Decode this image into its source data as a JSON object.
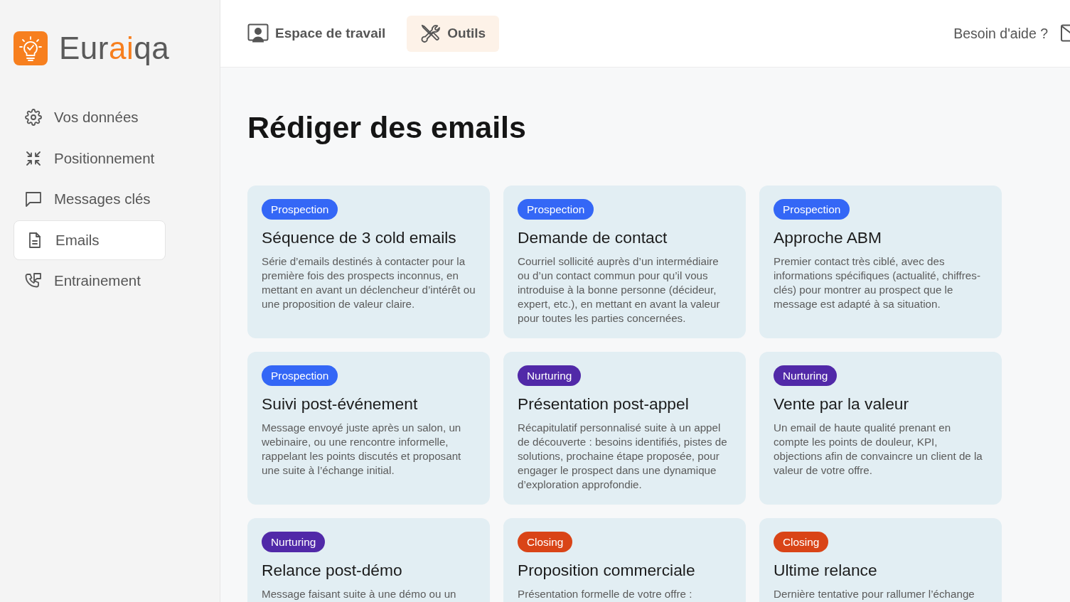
{
  "logo": {
    "parts": [
      {
        "text": "Eur",
        "accent": false
      },
      {
        "text": "ai",
        "accent": true
      },
      {
        "text": "qa",
        "accent": false
      }
    ]
  },
  "sidebar": {
    "items": [
      {
        "label": "Vos données",
        "selected": false
      },
      {
        "label": "Positionnement",
        "selected": false
      },
      {
        "label": "Messages clés",
        "selected": false
      },
      {
        "label": "Emails",
        "selected": true
      },
      {
        "label": "Entrainement",
        "selected": false
      }
    ]
  },
  "topbar": {
    "tabs": [
      {
        "label": "Espace de travail",
        "selected": false
      },
      {
        "label": "Outils",
        "selected": true
      }
    ],
    "help": "Besoin d'aide ?"
  },
  "page": {
    "title": "Rédiger des emails"
  },
  "cards": [
    {
      "tag": "Prospection",
      "color": "#3467f6",
      "title": "Séquence de 3 cold emails",
      "description": "Série d’emails destinés à contacter pour la première fois des prospects inconnus, en mettant en avant un déclencheur d’intérêt ou une proposition de valeur claire."
    },
    {
      "tag": "Prospection",
      "color": "#3467f6",
      "title": "Demande de contact",
      "description": "Courriel sollicité auprès d’un intermédiaire ou d’un contact commun pour qu’il vous introduise à la bonne personne (décideur, expert, etc.), en mettant en avant la valeur pour toutes les parties concernées."
    },
    {
      "tag": "Prospection",
      "color": "#3467f6",
      "title": "Approche ABM",
      "description": "Premier contact très ciblé, avec des informations spécifiques (actualité, chiffres-clés) pour montrer au prospect que le message est adapté à sa situation."
    },
    {
      "tag": "Prospection",
      "color": "#3467f6",
      "title": "Suivi post-événement",
      "description": "Message envoyé juste après un salon, un webinaire, ou une rencontre informelle, rappelant les points discutés et proposant une suite à l’échange initial."
    },
    {
      "tag": "Nurturing",
      "color": "#5129a8",
      "title": "Présentation post-appel",
      "description": "Récapitulatif personnalisé suite à un appel de découverte : besoins identifiés, pistes de solutions, prochaine étape proposée, pour engager le prospect dans une dynamique d’exploration approfondie."
    },
    {
      "tag": "Nurturing",
      "color": "#5129a8",
      "title": "Vente par la valeur",
      "description": "Un email de haute qualité prenant en compte les points de douleur, KPI, objections afin de convaincre un client de la valeur de votre offre."
    },
    {
      "tag": "Nurturing",
      "color": "#5129a8",
      "title": "Relance post-démo",
      "description": "Message faisant suite à une démo ou un"
    },
    {
      "tag": "Closing",
      "color": "#d94417",
      "title": "Proposition commerciale",
      "description": "Présentation formelle de votre offre :"
    },
    {
      "tag": "Closing",
      "color": "#d94417",
      "title": "Ultime relance",
      "description": "Dernière tentative pour rallumer l’échange"
    }
  ]
}
